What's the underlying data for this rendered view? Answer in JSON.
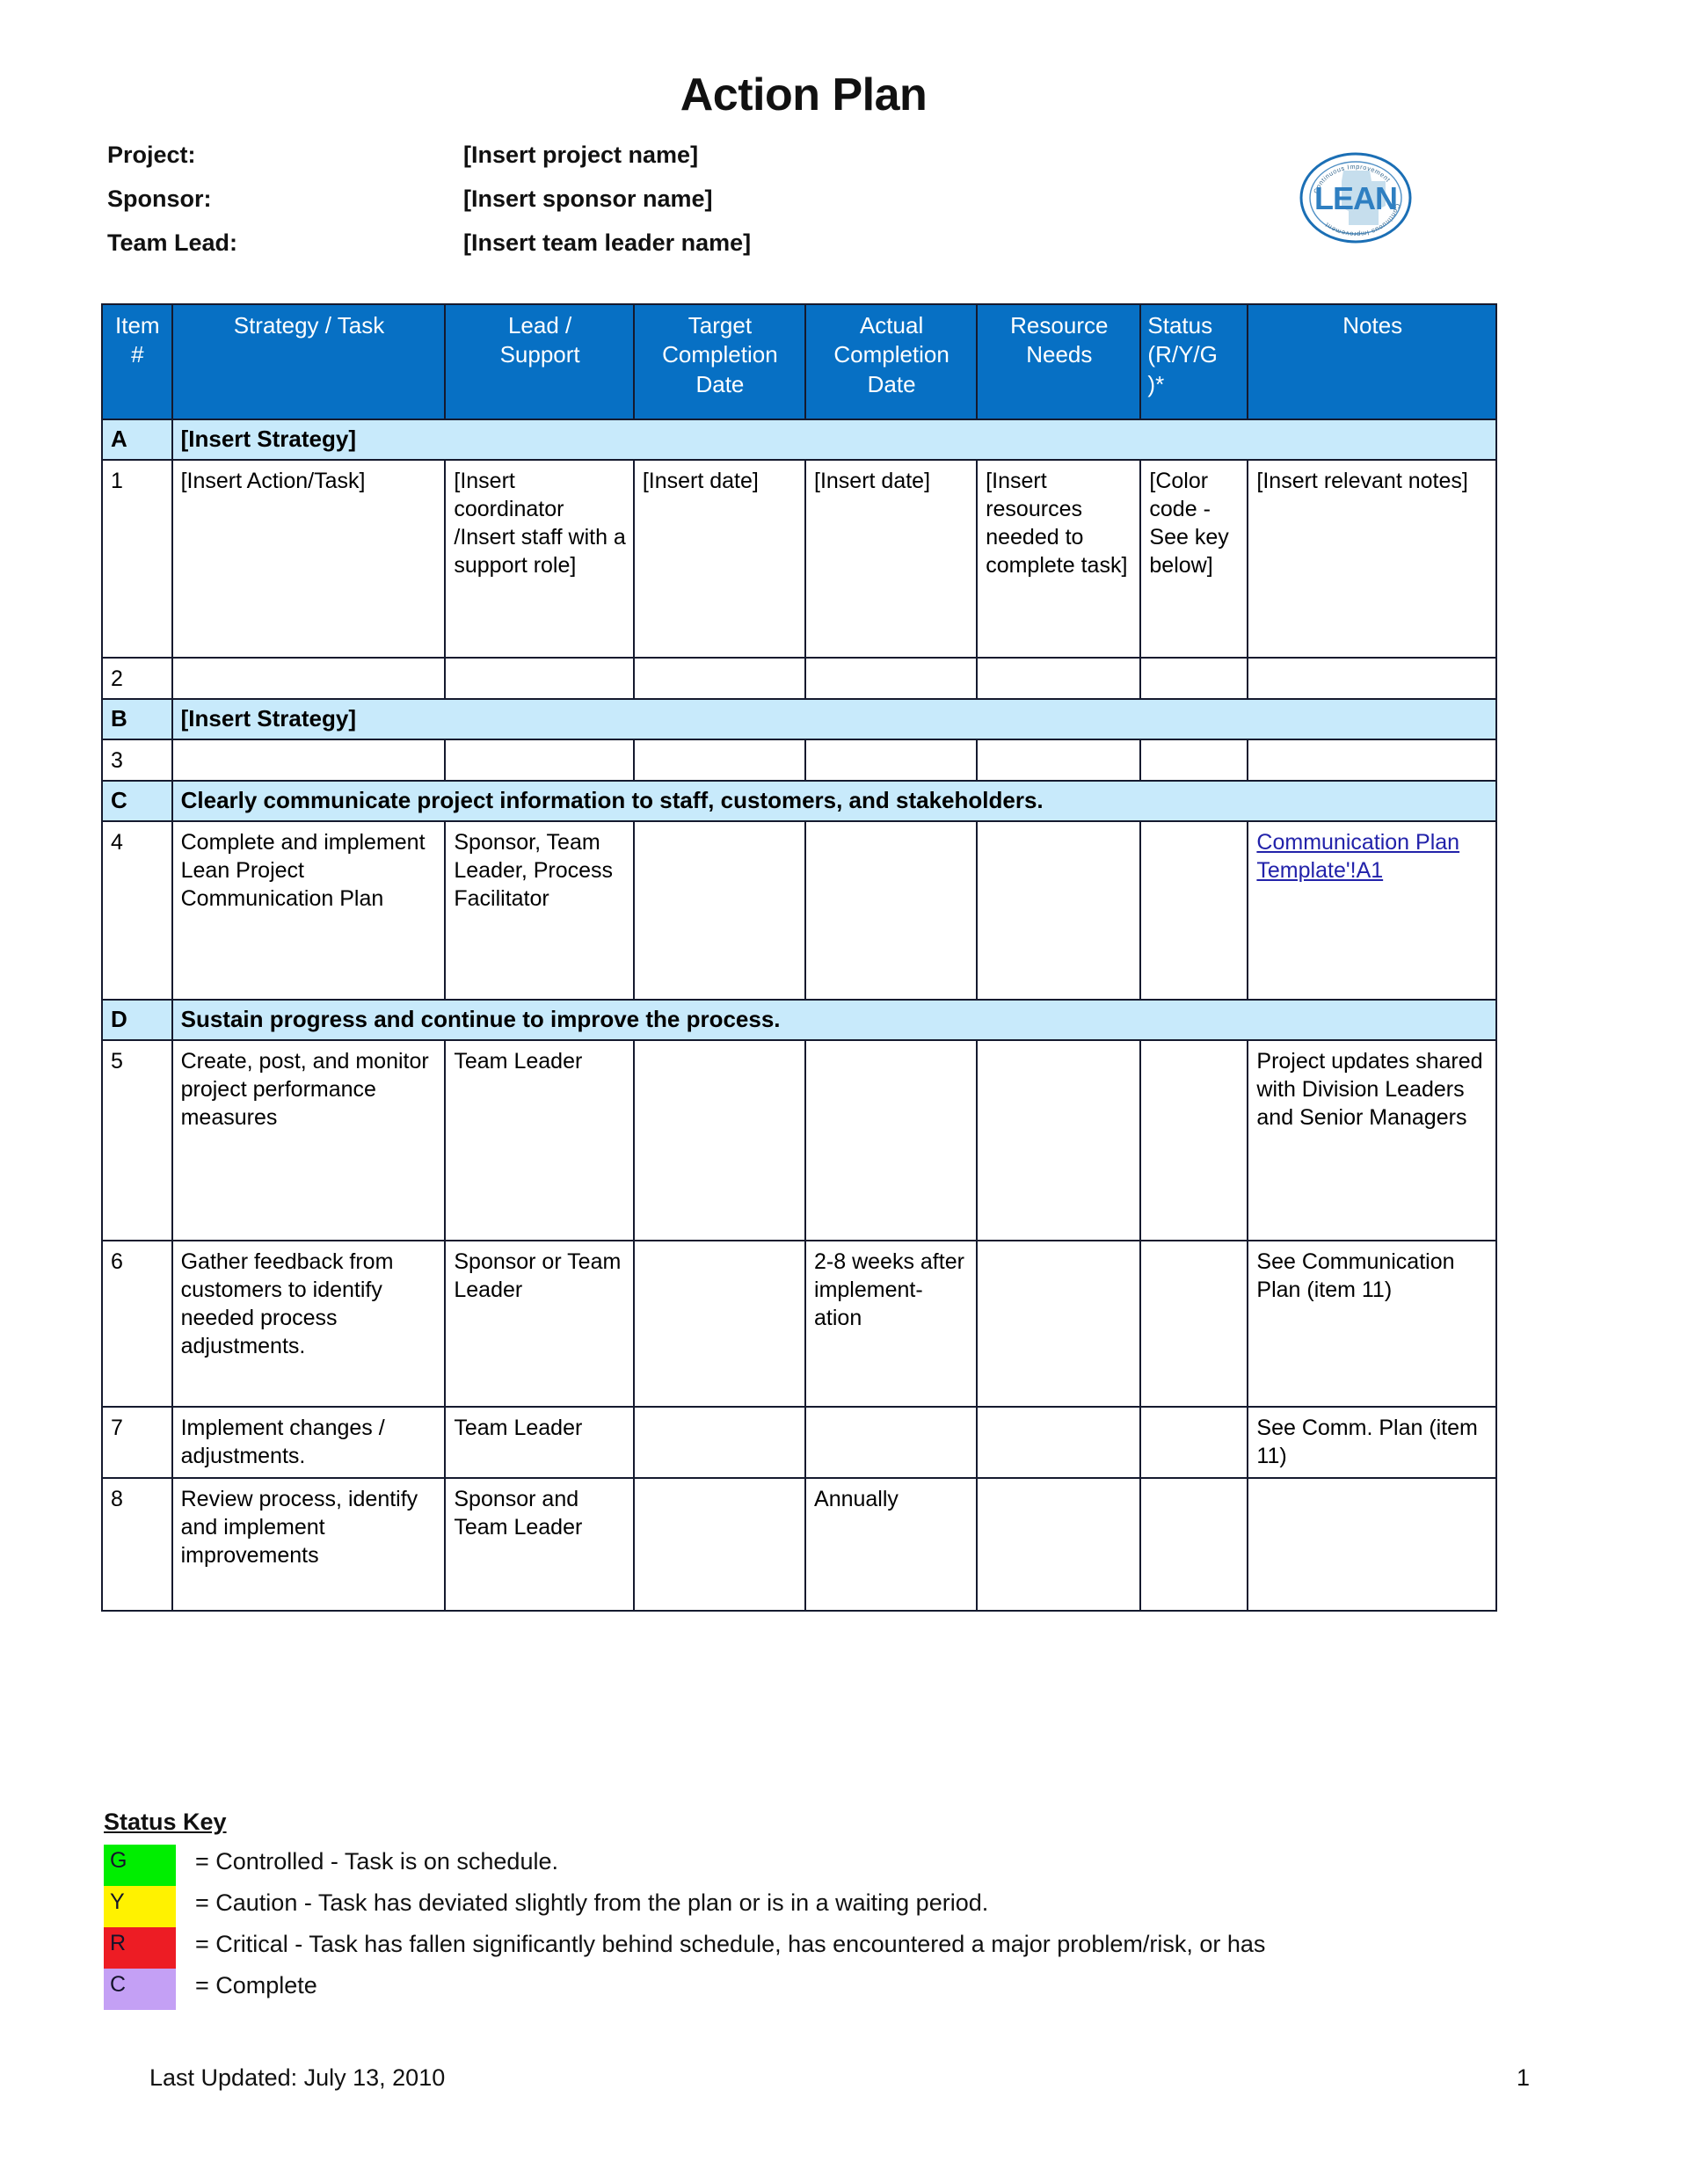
{
  "document": {
    "title": "Action Plan",
    "meta": [
      {
        "label": "Project:",
        "value": "[Insert project name]"
      },
      {
        "label": "Sponsor:",
        "value": "[Insert sponsor name]"
      },
      {
        "label": "Team Lead:",
        "value": "[Insert team leader name]"
      }
    ]
  },
  "logo": {
    "center_text": "LEAN",
    "ring_text": "Continuous Improvement",
    "ring_color": "#1b6fb5",
    "center_color": "#2f7fc1"
  },
  "table": {
    "headers": [
      "Item #",
      "Strategy / Task",
      "Lead / Support",
      "Target Completion Date",
      "Actual Completion Date",
      "Resource Needs",
      "Status (R/Y/G )*",
      "Notes"
    ],
    "header_lines": {
      "item": [
        "Item",
        "#"
      ],
      "strategy": [
        "Strategy / Task"
      ],
      "lead": [
        "Lead /",
        "Support"
      ],
      "target": [
        "Target",
        "Completion",
        "Date"
      ],
      "actual": [
        "Actual",
        "Completion",
        "Date"
      ],
      "resource": [
        "Resource",
        "Needs"
      ],
      "status": [
        "Status",
        "(R/Y/G",
        ")*"
      ],
      "notes": [
        "Notes"
      ]
    },
    "rows": [
      {
        "type": "strategy",
        "letter": "A",
        "text": "[Insert Strategy]"
      },
      {
        "type": "item",
        "num": "1",
        "task": "[Insert Action/Task]",
        "lead": "[Insert coordinator /Insert staff with a support role]",
        "target": "[Insert date]",
        "actual": "[Insert date]",
        "resource": "[Insert resources needed to complete task]",
        "status": "[Color code - See key below]",
        "notes": "[Insert relevant notes]"
      },
      {
        "type": "item",
        "num": "2",
        "task": "",
        "lead": "",
        "target": "",
        "actual": "",
        "resource": "",
        "status": "",
        "notes": ""
      },
      {
        "type": "strategy",
        "letter": "B",
        "text": "[Insert Strategy]"
      },
      {
        "type": "item",
        "num": "3",
        "task": "",
        "lead": "",
        "target": "",
        "actual": "",
        "resource": "",
        "status": "",
        "notes": ""
      },
      {
        "type": "strategy",
        "letter": "C",
        "text": "Clearly communicate project information to staff, customers, and stakeholders."
      },
      {
        "type": "item",
        "num": "4",
        "task": "Complete and implement Lean Project Communication Plan",
        "lead": "Sponsor, Team Leader, Process Facilitator",
        "target": "",
        "actual": "",
        "resource": "",
        "status": "",
        "notes_link": "Communication Plan Template'!A1",
        "notes": ""
      },
      {
        "type": "strategy",
        "letter": "D",
        "text": "Sustain progress and continue to improve the process."
      },
      {
        "type": "item",
        "num": "5",
        "task": "Create, post, and monitor project performance measures",
        "lead": "Team Leader",
        "target": "",
        "actual": "",
        "resource": "",
        "status": "",
        "notes": "Project updates shared with Division Leaders and Senior Managers"
      },
      {
        "type": "item",
        "num": "6",
        "task": "Gather feedback from customers to identify needed process adjustments.",
        "lead": "Sponsor or Team Leader",
        "target": "",
        "actual": "2-8 weeks after implement-ation",
        "resource": "",
        "status": "",
        "notes": "See Communication Plan (item 11)"
      },
      {
        "type": "item",
        "num": "7",
        "task": "Implement changes / adjustments.",
        "lead": "Team Leader",
        "target": "",
        "actual": "",
        "resource": "",
        "status": "",
        "notes": "See Comm. Plan (item 11)"
      },
      {
        "type": "item",
        "num": "8",
        "task": "Review process, identify and implement improvements",
        "lead": "Sponsor and Team Leader",
        "target": "",
        "actual": "Annually",
        "resource": "",
        "status": "",
        "notes": ""
      }
    ]
  },
  "status_key": {
    "title": "Status Key",
    "entries": [
      {
        "code": "G",
        "color": "#00ee00",
        "text": "= Controlled - Task is on schedule."
      },
      {
        "code": "Y",
        "color": "#fff200",
        "text": "= Caution - Task has deviated slightly from the plan or is in a waiting period."
      },
      {
        "code": "R",
        "color": "#ed1c24",
        "text": "= Critical - Task has fallen significantly behind schedule, has encountered a major problem/risk, or has"
      },
      {
        "code": "C",
        "color": "#c4a0f5",
        "text": "= Complete"
      }
    ]
  },
  "footer": {
    "last_updated": "Last Updated: July 13, 2010",
    "page_number": "1"
  },
  "colors": {
    "header_blue": "#0770c4",
    "strategy_blue": "#c8eafb",
    "link_blue": "#2222aa",
    "border": "#151a2e"
  }
}
